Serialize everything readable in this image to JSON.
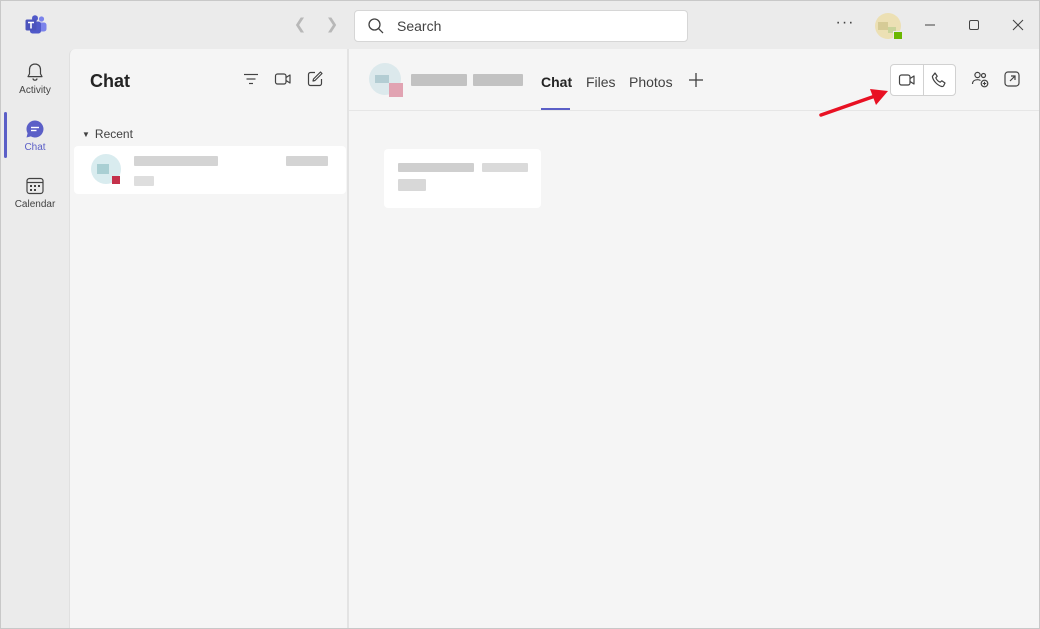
{
  "titlebar": {
    "search_placeholder": "Search",
    "more_label": "···"
  },
  "rail": {
    "items": [
      {
        "label": "Activity",
        "icon": "bell-icon"
      },
      {
        "label": "Chat",
        "icon": "chat-icon",
        "active": true
      },
      {
        "label": "Calendar",
        "icon": "calendar-icon"
      }
    ]
  },
  "list_panel": {
    "title": "Chat",
    "section": "Recent"
  },
  "main": {
    "tabs": [
      {
        "label": "Chat",
        "active": true
      },
      {
        "label": "Files"
      },
      {
        "label": "Photos"
      }
    ]
  },
  "colors": {
    "accent": "#5b5fc7",
    "annotation_arrow": "#e81123",
    "presence_busy": "#c4314b",
    "presence_available": "#6bb700"
  }
}
